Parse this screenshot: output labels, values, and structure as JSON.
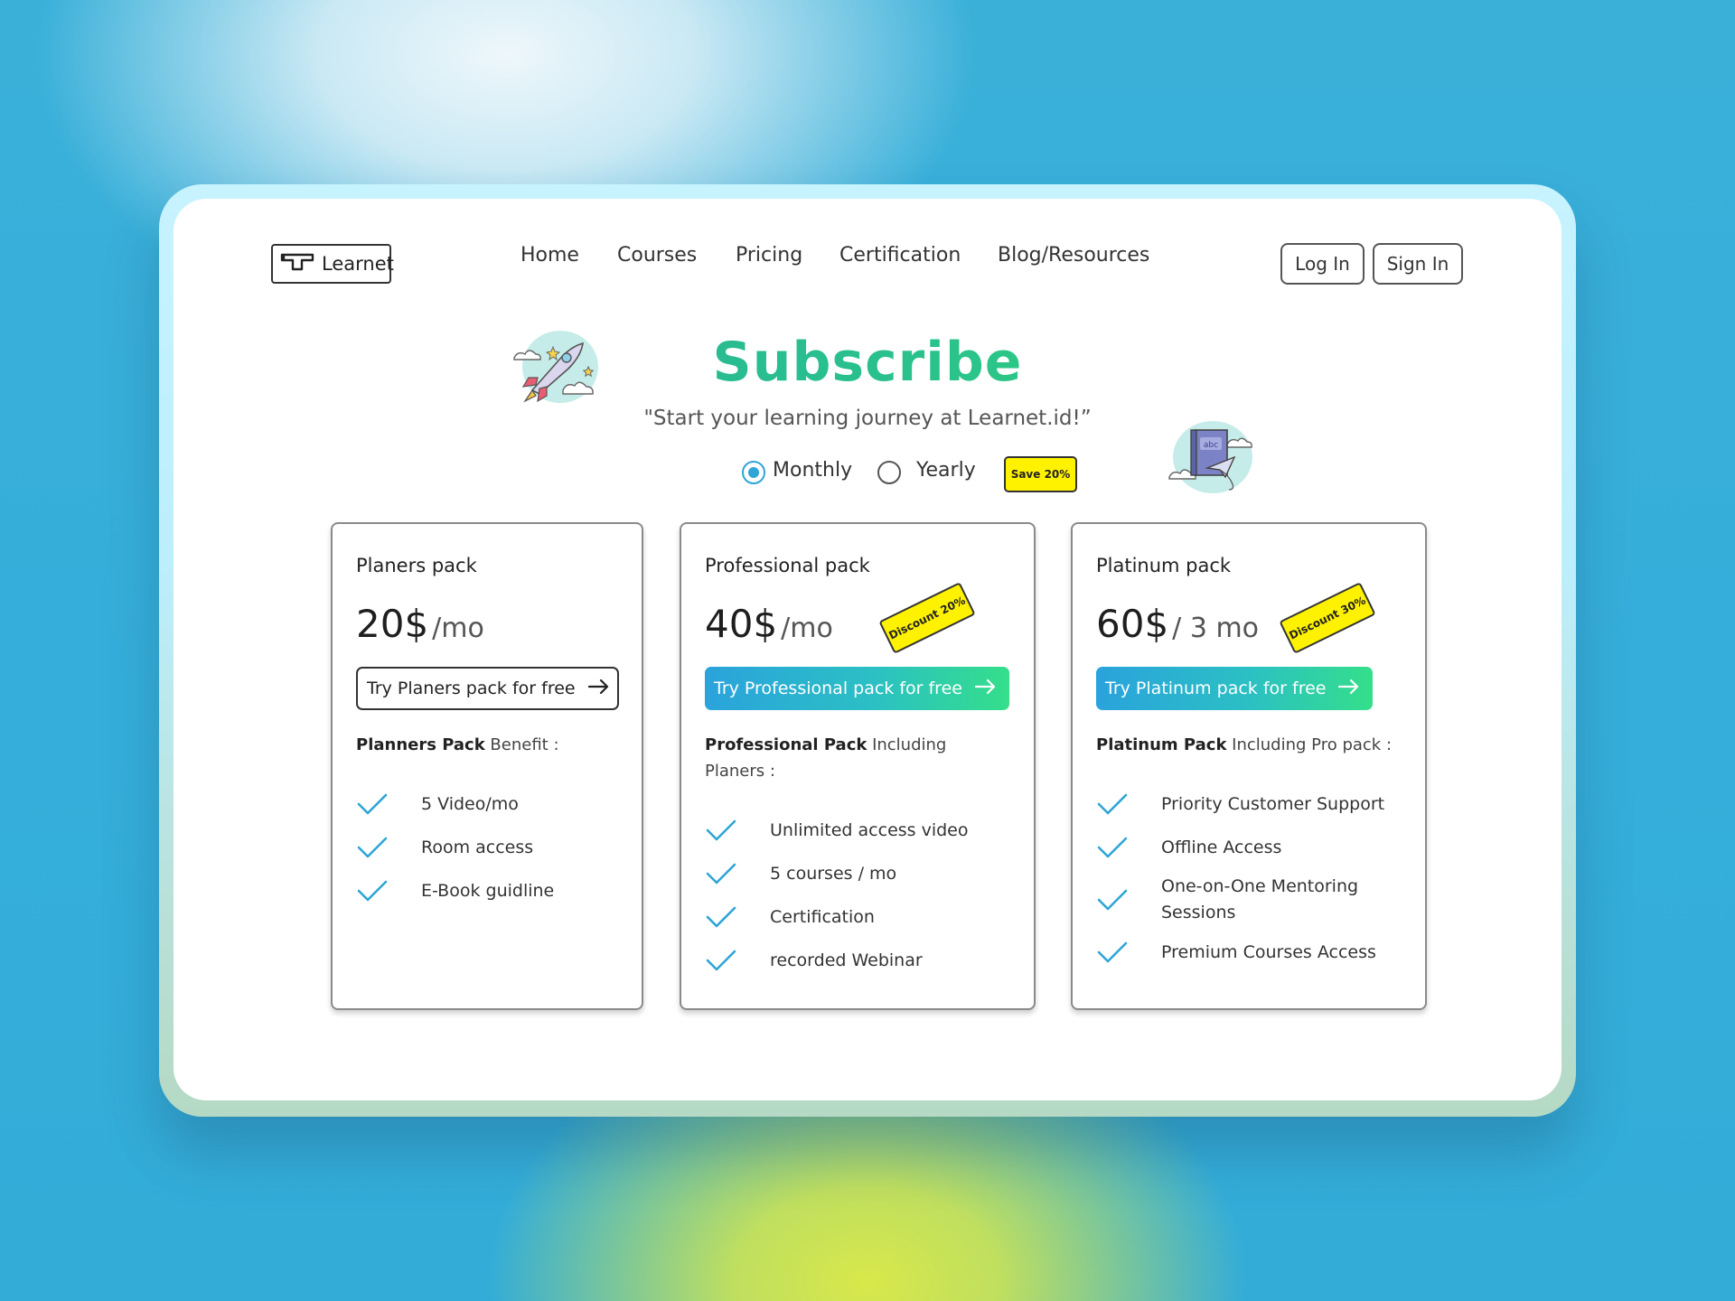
{
  "app": {
    "logo_text": "Learnet"
  },
  "nav": {
    "items": [
      "Home",
      "Courses",
      "Pricing",
      "Certification",
      "Blog/Resources"
    ]
  },
  "auth": {
    "login_label": "Log In",
    "signin_label": "Sign In"
  },
  "hero": {
    "title": "Subscribe",
    "subtitle": "\"Start your learning journey at Learnet.id!”"
  },
  "billing": {
    "options": [
      {
        "label": "Monthly",
        "selected": true
      },
      {
        "label": "Yearly",
        "selected": false
      }
    ],
    "save_badge": "Save 20%"
  },
  "plans": [
    {
      "name": "Planers pack",
      "price": "20$",
      "period": "/mo",
      "discount": "",
      "cta_label": "Try Planers pack for free",
      "cta_style": "outline",
      "benefit_bold": "Planners Pack",
      "benefit_rest": " Benefit :",
      "features": [
        "5 Video/mo",
        "Room access",
        "E-Book guidline"
      ]
    },
    {
      "name": "Professional pack",
      "price": "40$",
      "period": "/mo",
      "discount": "Discount 20%",
      "cta_label": "Try Professional pack for free",
      "cta_style": "gradient",
      "benefit_bold": "Professional Pack",
      "benefit_rest": " Including Planers :",
      "features": [
        "Unlimited access video",
        "5 courses / mo",
        "Certification",
        "recorded Webinar"
      ]
    },
    {
      "name": "Platinum pack",
      "price": "60$",
      "period": "/ 3 mo",
      "discount": "Discount 30%",
      "cta_label": "Try Platinum pack for free",
      "cta_style": "gradient",
      "benefit_bold": "Platinum Pack",
      "benefit_rest": " Including Pro pack :",
      "features": [
        "Priority Customer Support",
        "Offline Access",
        "One-on-One Mentoring Sessions",
        "Premium Courses Access"
      ]
    }
  ],
  "colors": {
    "accent_blue": "#2ea5d6",
    "accent_green": "#34df8a",
    "badge_yellow": "#fff200",
    "title_teal": "#2ba89a"
  },
  "icons": {
    "logo": "logo-icon",
    "arrow": "arrow-right-icon",
    "check": "check-icon",
    "rocket": "rocket-illustration",
    "book": "book-illustration"
  }
}
